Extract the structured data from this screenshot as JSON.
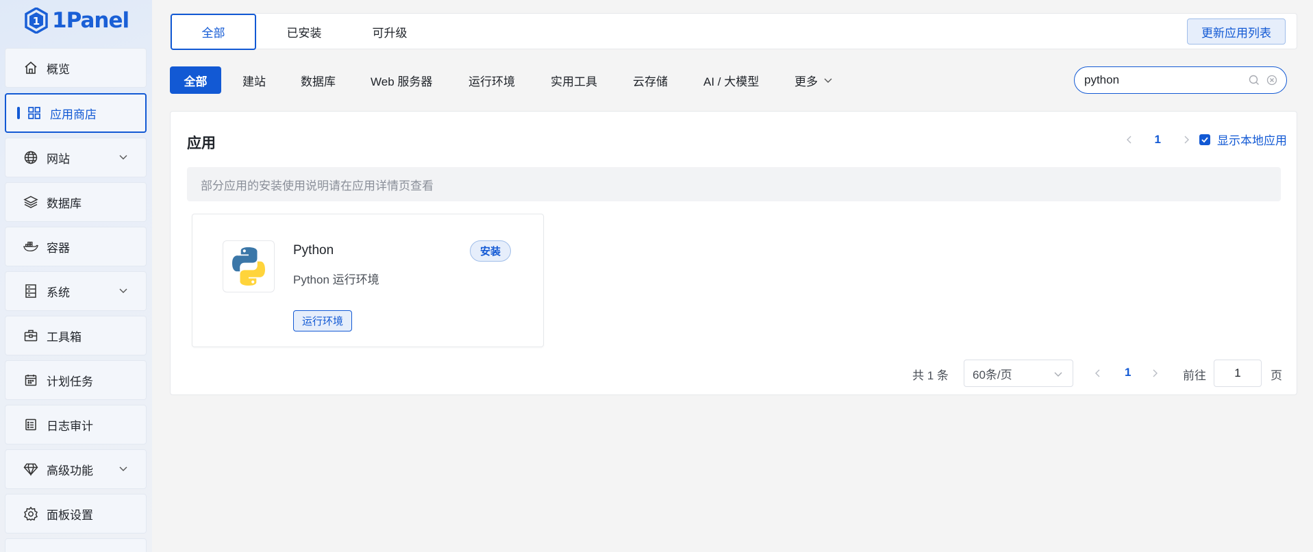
{
  "brand": {
    "logo_text": "1Panel"
  },
  "sidebar": {
    "items": [
      {
        "label": "概览",
        "icon": "home-icon"
      },
      {
        "label": "应用商店",
        "icon": "grid-icon",
        "active": true
      },
      {
        "label": "网站",
        "icon": "globe-icon",
        "expandable": true
      },
      {
        "label": "数据库",
        "icon": "layers-icon"
      },
      {
        "label": "容器",
        "icon": "docker-icon"
      },
      {
        "label": "系统",
        "icon": "server-icon",
        "expandable": true
      },
      {
        "label": "工具箱",
        "icon": "toolbox-icon"
      },
      {
        "label": "计划任务",
        "icon": "calendar-icon"
      },
      {
        "label": "日志审计",
        "icon": "log-icon"
      },
      {
        "label": "高级功能",
        "icon": "diamond-icon",
        "expandable": true
      },
      {
        "label": "面板设置",
        "icon": "gear-icon"
      }
    ]
  },
  "top_tabs": {
    "all": "全部",
    "installed": "已安装",
    "upgradable": "可升级",
    "update_button": "更新应用列表"
  },
  "categories": {
    "all": "全部",
    "website": "建站",
    "database": "数据库",
    "web_server": "Web 服务器",
    "runtime": "运行环境",
    "tools": "实用工具",
    "storage": "云存储",
    "ai": "AI / 大模型",
    "more": "更多"
  },
  "search": {
    "value": "python"
  },
  "apps_section": {
    "title": "应用",
    "page": "1",
    "show_local": "显示本地应用",
    "notice": "部分应用的安装使用说明请在应用详情页查看"
  },
  "app": {
    "name": "Python",
    "description": "Python 运行环境",
    "install": "安装",
    "tag": "运行环境"
  },
  "pagination": {
    "total": "共 1 条",
    "page_size": "60条/页",
    "current": "1",
    "goto_label": "前往",
    "goto_value": "1",
    "page_suffix": "页"
  },
  "colors": {
    "primary": "#1259d4",
    "python_blue": "#3b77a8",
    "python_yellow": "#ffd43b"
  }
}
